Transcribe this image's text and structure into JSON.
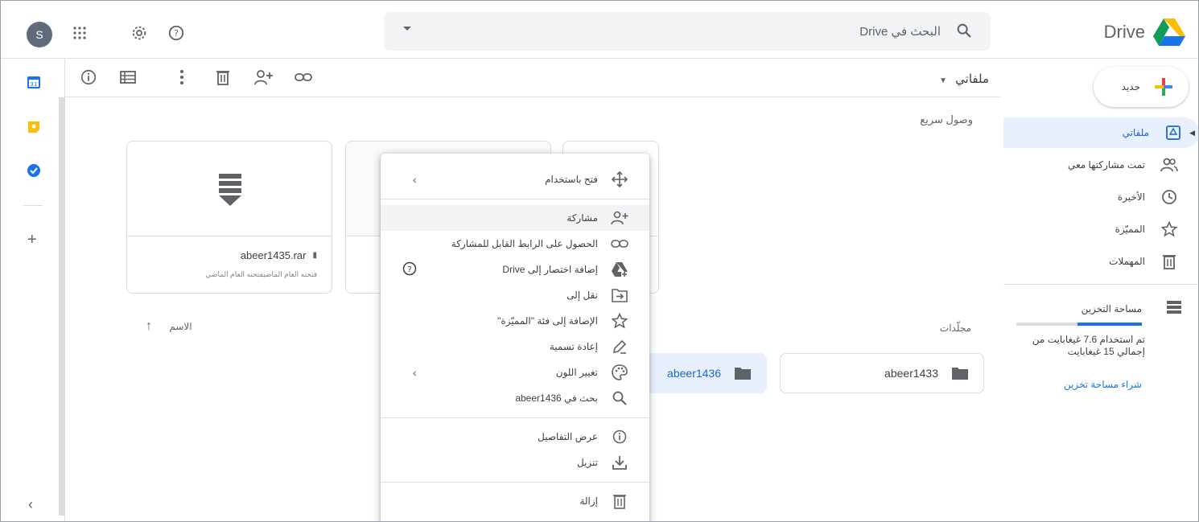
{
  "topbar": {
    "avatar_letter": "S",
    "search_placeholder": "البحث في Drive",
    "brand": "Drive"
  },
  "toolbar": {
    "breadcrumb": "ملفاتي"
  },
  "quick_access": {
    "label": "وصول سريع",
    "file_name": "abeer1435.rar",
    "file_sub": "فتحته العام الماضيفتحته العام الماضي"
  },
  "list": {
    "sort_label": "الاسم",
    "folders_label": "مجلّدات",
    "folders": [
      {
        "name": "abeer1436"
      },
      {
        "name": "abeer1433"
      }
    ]
  },
  "sidebar": {
    "new_label": "جديد",
    "items": [
      {
        "label": "ملفاتي"
      },
      {
        "label": "تمت مشاركتها معي"
      },
      {
        "label": "الأخيرة"
      },
      {
        "label": "المميّزة"
      },
      {
        "label": "المهملات"
      }
    ],
    "storage_title": "مساحة التخزين",
    "storage_text": "تم استخدام 7.6 غيغابايت من إجمالي 15 غيغابايت",
    "storage_used_fraction": 0.51,
    "buy_storage": "شراء مساحة تخزين"
  },
  "context_menu": {
    "items": [
      {
        "label": "فتح باستخدام"
      },
      {
        "label": "مشاركة"
      },
      {
        "label": "الحصول على الرابط القابل للمشاركة"
      },
      {
        "label": "إضافة اختصار إلى Drive"
      },
      {
        "label": "نقل إلى"
      },
      {
        "label": "الإضافة إلى فئة \"المميّزة\""
      },
      {
        "label": "إعادة تسمية"
      },
      {
        "label": "تغيير اللون"
      },
      {
        "label": "بحث في abeer1436"
      },
      {
        "label": "عرض التفاصيل"
      },
      {
        "label": "تنزيل"
      },
      {
        "label": "إزالة"
      }
    ]
  },
  "colors": {
    "accent": "#1a73e8",
    "selected_bg": "#e8f0fe"
  }
}
